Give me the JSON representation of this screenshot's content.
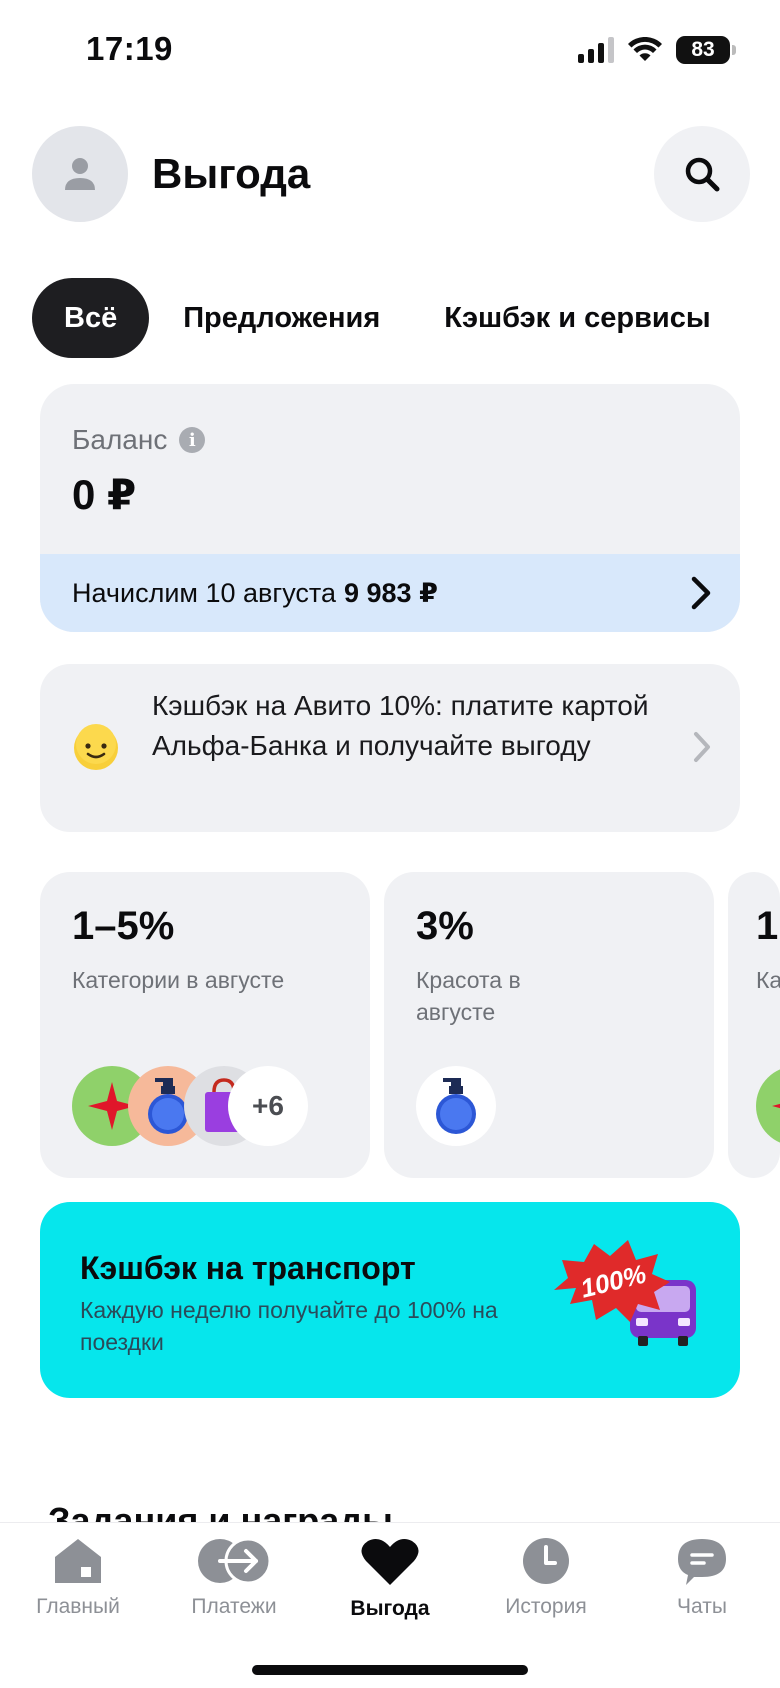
{
  "status_bar": {
    "time": "17:19",
    "battery": "83"
  },
  "header": {
    "title": "Выгода"
  },
  "tabs": [
    {
      "label": "Всё",
      "active": true
    },
    {
      "label": "Предложения",
      "active": false
    },
    {
      "label": "Кэшбэк и сервисы",
      "active": false
    }
  ],
  "balance": {
    "label": "Баланс",
    "amount": "0 ₽",
    "accrual_text": "Начислим 10 августа",
    "accrual_amount": "9 983 ₽"
  },
  "promo": {
    "text": "Кэшбэк на Авито 10%: платите картой Альфа-Банка и получайте выгоду"
  },
  "cashback_cards": [
    {
      "percent": "1–5%",
      "description": "Категории в августе",
      "more": "+6"
    },
    {
      "percent": "3%",
      "description": "Красота в августе"
    },
    {
      "percent": "1",
      "description": "Ка"
    }
  ],
  "transport": {
    "title": "Кэшбэк на транспорт",
    "subtitle": "Каждую неделю получайте до 100% на поездки",
    "badge": "100%"
  },
  "section_peek": "Задания и награды",
  "bottom_nav": [
    {
      "label": "Главный",
      "icon": "home-icon",
      "active": false
    },
    {
      "label": "Платежи",
      "icon": "transfer-icon",
      "active": false
    },
    {
      "label": "Выгода",
      "icon": "heart-icon",
      "active": true
    },
    {
      "label": "История",
      "icon": "clock-icon",
      "active": false
    },
    {
      "label": "Чаты",
      "icon": "chat-icon",
      "active": false
    }
  ],
  "colors": {
    "accent_cyan": "#06e6ec",
    "accrual_bg": "#d8e8fb",
    "card_bg": "#f0f1f4",
    "active_tab": "#1e1e21"
  }
}
